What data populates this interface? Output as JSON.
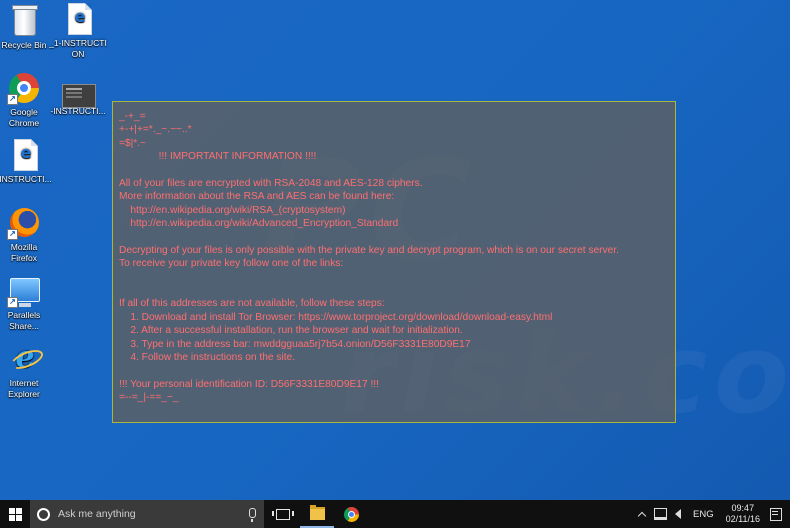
{
  "desktop": {
    "icons": [
      {
        "label": "Recycle Bin",
        "icon": "recycle-bin-icon"
      },
      {
        "label": "_1-INSTRUCTI\nON",
        "icon": "document-icon"
      },
      {
        "label": "Google\nChrome",
        "icon": "chrome-icon"
      },
      {
        "label": "-INSTRUCTI...",
        "icon": "image-thumbnail-icon"
      },
      {
        "label": "-INSTRUCTI...",
        "icon": "document-icon"
      },
      {
        "label": "Mozilla\nFirefox",
        "icon": "firefox-icon"
      },
      {
        "label": "Parallels\nShare...",
        "icon": "parallels-icon"
      },
      {
        "label": "Internet\nExplorer",
        "icon": "internet-explorer-icon"
      }
    ]
  },
  "note": {
    "lines": [
      "_-+_=",
      "+-+|+=*._~.~~..*",
      "=$|*.~",
      "              !!! IMPORTANT INFORMATION !!!!",
      "",
      "All of your files are encrypted with RSA-2048 and AES-128 ciphers.",
      "More information about the RSA and AES can be found here:",
      "    http://en.wikipedia.org/wiki/RSA_(cryptosystem)",
      "    http://en.wikipedia.org/wiki/Advanced_Encryption_Standard",
      "",
      "Decrypting of your files is only possible with the private key and decrypt program, which is on our secret server.",
      "To receive your private key follow one of the links:",
      "",
      "",
      "If all of this addresses are not available, follow these steps:",
      "    1. Download and install Tor Browser: https://www.torproject.org/download/download-easy.html",
      "    2. After a successful installation, run the browser and wait for initialization.",
      "    3. Type in the address bar: mwddgguaa5rj7b54.onion/D56F3331E80D9E17",
      "    4. Follow the instructions on the site.",
      "",
      "!!! Your personal identification ID: D56F3331E80D9E17 !!!",
      "=--=_|-==_~_"
    ]
  },
  "taskbar": {
    "search_placeholder": "Ask me anything",
    "language": "ENG",
    "time": "09:47",
    "date": "02/11/16"
  },
  "colors": {
    "desktop_bg": "#1767c2",
    "note_text": "#ff6f6f",
    "note_border": "#a8b640",
    "taskbar_bg": "#101010"
  }
}
